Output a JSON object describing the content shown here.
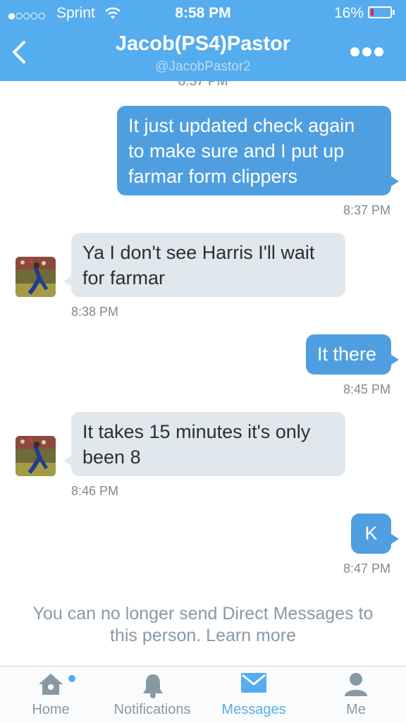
{
  "status_bar": {
    "signal": "●○○○○",
    "carrier": "Sprint",
    "time": "8:58 PM",
    "battery": "16%"
  },
  "header": {
    "title": "Jacob(PS4)Pastor",
    "handle": "@JacobPastor2",
    "cut_timestamp": "8:37 PM"
  },
  "messages": [
    {
      "dir": "out",
      "lines": [
        "It just updated check again",
        "to make sure and I put up",
        "farmar form clippers"
      ],
      "time": "8:37 PM"
    },
    {
      "dir": "in",
      "lines": [
        "Ya I don't see Harris I'll wait",
        "for farmar"
      ],
      "time": "8:38 PM"
    },
    {
      "dir": "out",
      "lines": [
        "It there"
      ],
      "time": "8:45 PM"
    },
    {
      "dir": "in",
      "lines": [
        "It takes 15 minutes it's only",
        "been 8"
      ],
      "time": "8:46 PM"
    },
    {
      "dir": "out",
      "lines": [
        "K"
      ],
      "time": "8:47 PM"
    }
  ],
  "notice": {
    "line1": "You can no longer send Direct Messages to",
    "line2": "this person. Learn more"
  },
  "tabs": [
    {
      "label": "Home",
      "icon": "home-icon",
      "active": false
    },
    {
      "label": "Notifications",
      "icon": "bell-icon",
      "active": false
    },
    {
      "label": "Messages",
      "icon": "envelope-icon",
      "active": true
    },
    {
      "label": "Me",
      "icon": "person-icon",
      "active": false
    }
  ],
  "colors": {
    "brand": "#55acee",
    "outgoing_bubble": "#4f9fe0",
    "incoming_bubble": "#e1e8ed",
    "battery_low": "#e0262a"
  }
}
